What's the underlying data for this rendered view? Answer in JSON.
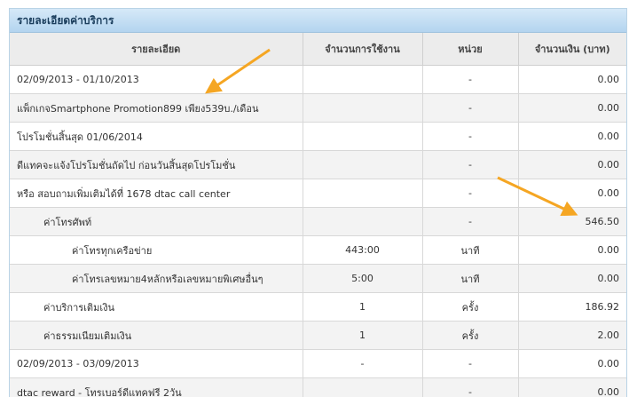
{
  "panel": {
    "title": "รายละเอียดค่าบริการ"
  },
  "table": {
    "headers": [
      "รายละเอียด",
      "จำนวนการใช้งาน",
      "หน่วย",
      "จำนวนเงิน (บาท)"
    ],
    "rows": [
      {
        "detail": "02/09/2013 - 01/10/2013",
        "usage": "",
        "unit": "-",
        "amount": "0.00"
      },
      {
        "detail": "แพ็กเกจSmartphone Promotion899 เพียง539บ./เดือน",
        "usage": "",
        "unit": "-",
        "amount": "0.00"
      },
      {
        "detail": "โปรโมชั่นสิ้นสุด 01/06/2014",
        "usage": "",
        "unit": "-",
        "amount": "0.00"
      },
      {
        "detail": "ดีแทคจะแจ้งโปรโมชั่นถัดไป ก่อนวันสิ้นสุดโปรโมชั่น",
        "usage": "",
        "unit": "-",
        "amount": "0.00"
      },
      {
        "detail": "หรือ สอบถามเพิ่มเติมได้ที่ 1678 dtac call center",
        "usage": "",
        "unit": "-",
        "amount": "0.00"
      },
      {
        "detail": "ค่าโทรศัพท์",
        "usage": "",
        "unit": "-",
        "amount": "546.50"
      },
      {
        "detail": "ค่าโทรทุกเครือข่าย",
        "usage": "443:00",
        "unit": "นาที",
        "amount": "0.00"
      },
      {
        "detail": "ค่าโทรเลขหมาย4หลักหรือเลขหมายพิเศษอื่นๆ",
        "usage": "5:00",
        "unit": "นาที",
        "amount": "0.00"
      },
      {
        "detail": "ค่าบริการเติมเงิน",
        "usage": "1",
        "unit": "ครั้ง",
        "amount": "186.92"
      },
      {
        "detail": "ค่าธรรมเนียมเติมเงิน",
        "usage": "1",
        "unit": "ครั้ง",
        "amount": "2.00"
      },
      {
        "detail": "02/09/2013 - 03/09/2013",
        "usage": "-",
        "unit": "-",
        "amount": "0.00"
      },
      {
        "detail": "dtac reward - โทรเบอร์ดีแทคฟรี 2วัน",
        "usage": "",
        "unit": "-",
        "amount": "0.00"
      }
    ]
  },
  "colors": {
    "header_bar": "#b3d4ef",
    "arrow": "#f5a623"
  },
  "annotations": [
    "arrow-icon",
    "arrow-icon"
  ]
}
